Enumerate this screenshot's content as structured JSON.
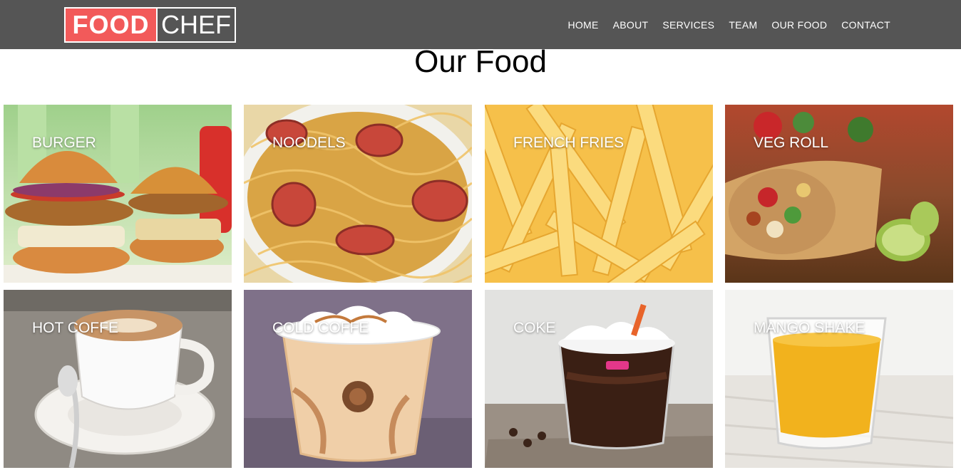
{
  "logo": {
    "part1": "FOOD",
    "part2": "CHEF"
  },
  "nav": [
    "HOME",
    "ABOUT",
    "SERVICES",
    "TEAM",
    "OUR FOOD",
    "CONTACT"
  ],
  "section_title": "Our Food",
  "foods": [
    {
      "label": "BURGER",
      "icon": "burger-image"
    },
    {
      "label": "NOODELS",
      "icon": "noodles-image"
    },
    {
      "label": "FRENCH FRIES",
      "icon": "french-fries-image"
    },
    {
      "label": "VEG ROLL",
      "icon": "veg-roll-image"
    },
    {
      "label": "HOT COFFE",
      "icon": "hot-coffee-image"
    },
    {
      "label": "COLD COFFE",
      "icon": "cold-coffee-image"
    },
    {
      "label": "COKE",
      "icon": "coke-image"
    },
    {
      "label": "MANGO SHAKE",
      "icon": "mango-shake-image"
    }
  ],
  "colors": {
    "navbar": "#555555",
    "logo_accent": "#f25a5a"
  }
}
